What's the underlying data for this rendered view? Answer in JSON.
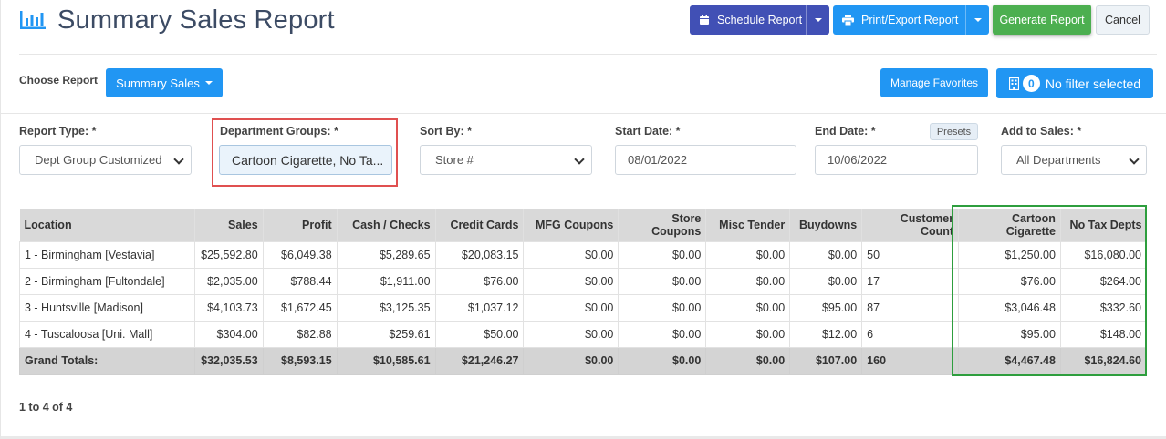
{
  "header": {
    "title": "Summary Sales Report",
    "schedule_label": "Schedule Report",
    "print_label": "Print/Export Report",
    "generate_label": "Generate Report",
    "cancel_label": "Cancel"
  },
  "choose": {
    "label": "Choose Report",
    "report_value": "Summary Sales",
    "favorites_label": "Manage Favorites",
    "filter_count": "0",
    "filter_label": "No filter selected"
  },
  "filters": {
    "report_type": {
      "label": "Report Type: *",
      "value": "Dept Group Customized"
    },
    "department_groups": {
      "label": "Department Groups: *",
      "value": "Cartoon Cigarette, No Ta..."
    },
    "sort_by": {
      "label": "Sort By: *",
      "value": "Store #"
    },
    "start_date": {
      "label": "Start Date: *",
      "value": "08/01/2022"
    },
    "end_date": {
      "label": "End Date: *",
      "value": "10/06/2022",
      "presets_label": "Presets"
    },
    "add_to_sales": {
      "label": "Add to Sales: *",
      "value": "All Departments"
    }
  },
  "table": {
    "columns": [
      "Location",
      "Sales",
      "Profit",
      "Cash / Checks",
      "Credit Cards",
      "MFG Coupons",
      "Store Coupons",
      "Misc Tender",
      "Buydowns",
      "Customer Count",
      "Cartoon Cigarette",
      "No Tax Depts"
    ],
    "rows": [
      [
        "1 - Birmingham [Vestavia]",
        "$25,592.80",
        "$6,049.38",
        "$5,289.65",
        "$20,083.15",
        "$0.00",
        "$0.00",
        "$0.00",
        "$0.00",
        "50",
        "$1,250.00",
        "$16,080.00"
      ],
      [
        "2 - Birmingham [Fultondale]",
        "$2,035.00",
        "$788.44",
        "$1,911.00",
        "$76.00",
        "$0.00",
        "$0.00",
        "$0.00",
        "$0.00",
        "17",
        "$76.00",
        "$264.00"
      ],
      [
        "3 - Huntsville [Madison]",
        "$4,103.73",
        "$1,672.45",
        "$3,125.35",
        "$1,037.12",
        "$0.00",
        "$0.00",
        "$0.00",
        "$95.00",
        "87",
        "$3,046.48",
        "$332.60"
      ],
      [
        "4 - Tuscaloosa [Uni. Mall]",
        "$304.00",
        "$82.88",
        "$259.61",
        "$50.00",
        "$0.00",
        "$0.00",
        "$0.00",
        "$12.00",
        "6",
        "$95.00",
        "$148.00"
      ]
    ],
    "totals": [
      "Grand Totals:",
      "$32,035.53",
      "$8,593.15",
      "$10,585.61",
      "$21,246.27",
      "$0.00",
      "$0.00",
      "$0.00",
      "$107.00",
      "160",
      "$4,467.48",
      "$16,824.60"
    ]
  },
  "pager": {
    "text": "1 to 4 of 4"
  },
  "colors": {
    "schedule": "#4150b5",
    "primary": "#2196f3",
    "generate": "#4caf50",
    "highlight_red": "#e05050",
    "highlight_green": "#2e9e3e"
  }
}
